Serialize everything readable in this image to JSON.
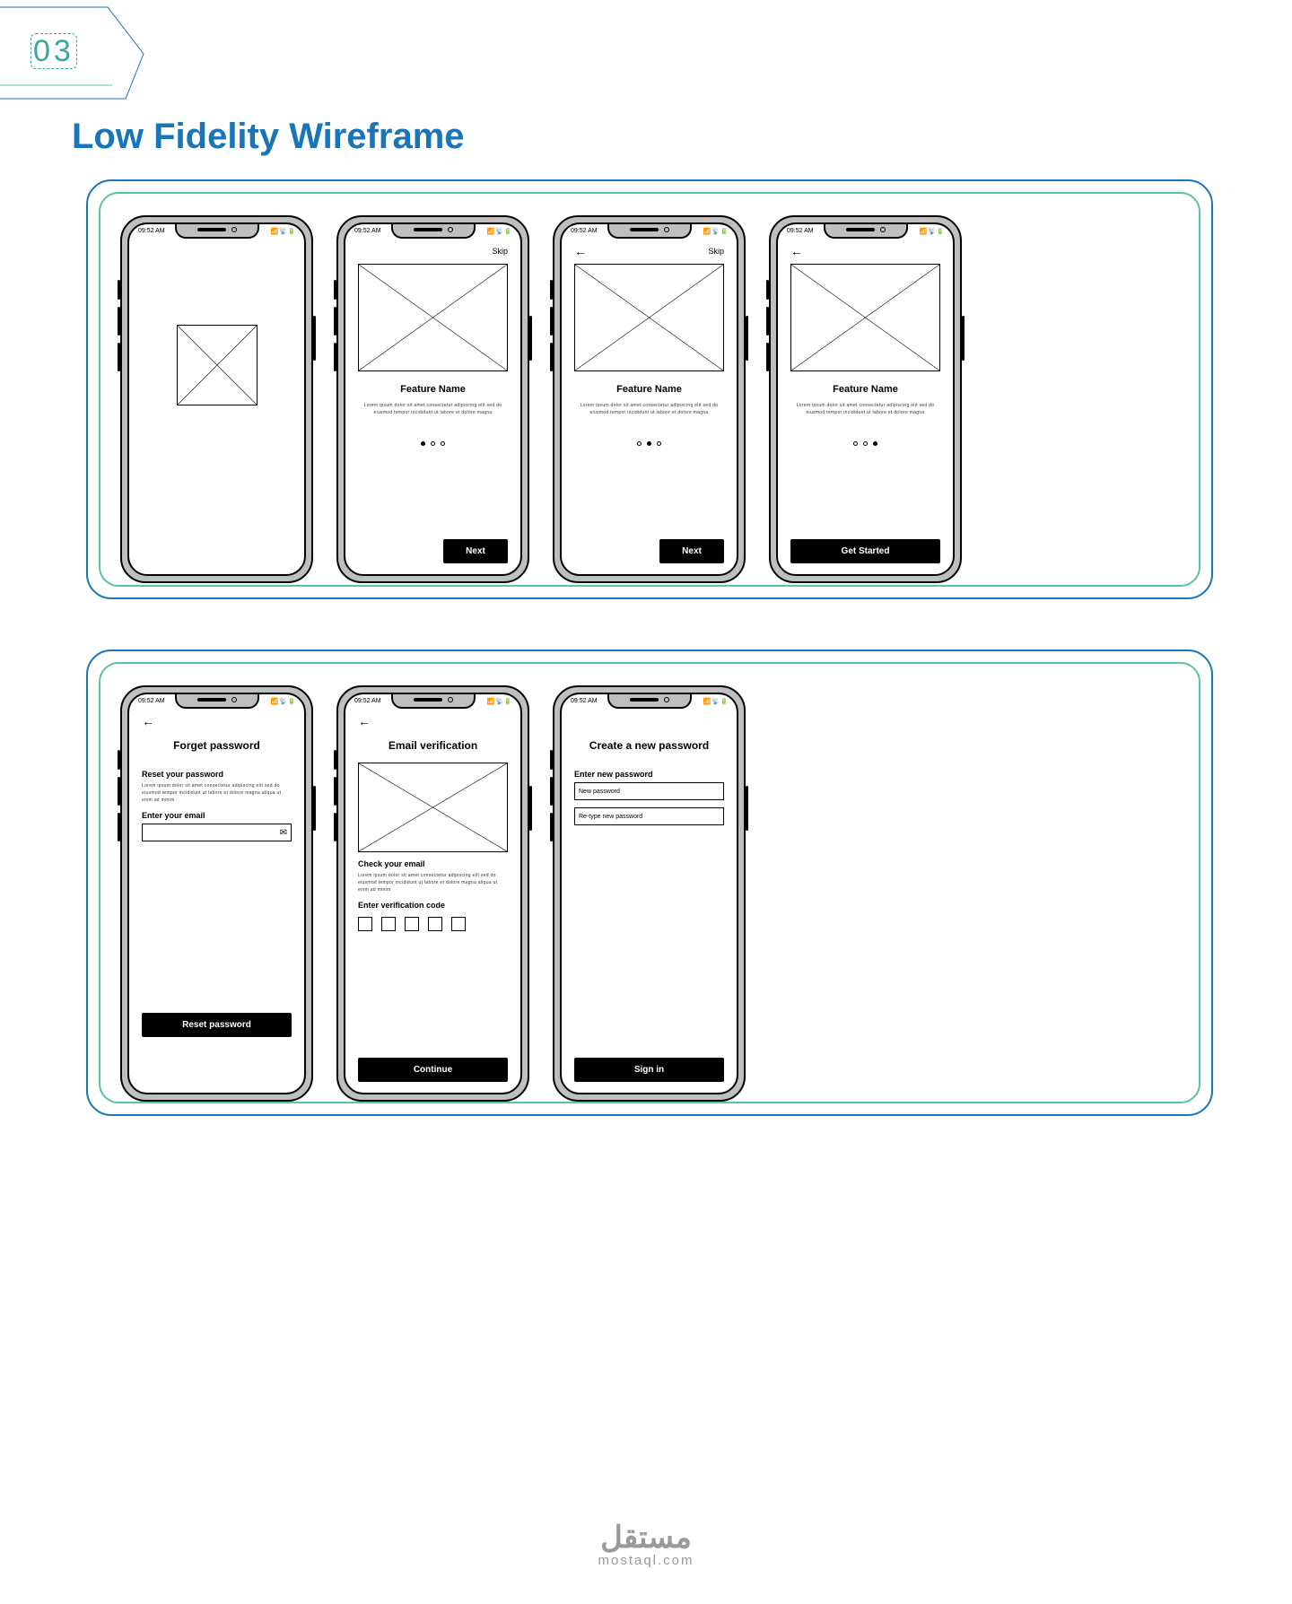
{
  "page": {
    "number": "03",
    "title": "Low Fidelity Wireframe"
  },
  "status": {
    "time": "09:52 AM",
    "right": "📶 📡 🔋"
  },
  "onboarding": {
    "skip": "Skip",
    "feature_title": "Feature Name",
    "lorem": "Lorem ipsum dolor sit amet consectetur adipiscing elit sed do eiusmod tempor incididunt ut labore et dolore magna",
    "next": "Next",
    "get_started": "Get Started"
  },
  "forgot": {
    "title": "Forget password",
    "subtitle": "Reset your password",
    "lorem": "Lorem ipsum dolor sit amet consectetur adipiscing elit sed do eiusmod tempor incididunt ut labore et dolore magna aliqua ut enim ad minim",
    "email_label": "Enter your email",
    "button": "Reset password"
  },
  "verify": {
    "title": "Email verification",
    "check_label": "Check your email",
    "lorem": "Lorem ipsum dolor sit amet consectetur adipiscing elit sed do eiusmod tempor incididunt ut labore et dolore magna aliqua ut enim ad minim",
    "code_label": "Enter verification code",
    "button": "Continue"
  },
  "newpass": {
    "title": "Create a new password",
    "label": "Enter new password",
    "ph1": "New password",
    "ph2": "Re-type new password",
    "button": "Sign in"
  },
  "footer": {
    "ar": "مستقل",
    "en": "mostaql.com"
  }
}
